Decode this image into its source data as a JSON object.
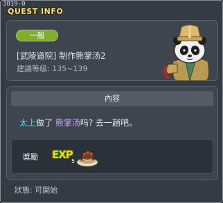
{
  "window": {
    "id_label": "3819-0",
    "title": "QUEST INFO"
  },
  "quest": {
    "category_badge": "一般",
    "name": "[武陵道院] 制作熊掌汤2",
    "level_range": "建議等级: 135~139",
    "npc_icon": "panda-chef-npc-icon"
  },
  "content": {
    "header": "內容",
    "desc_npc": "太上",
    "desc_part1": "做了",
    "desc_item": "熊掌汤",
    "desc_part2": "吗? 去一趟吧。"
  },
  "reward": {
    "label": "獎勵",
    "exp_label": "EXP",
    "exp_sub": "5",
    "item_icon": "bear-paw-soup-icon"
  },
  "status": {
    "text": "狀態: 可開始"
  },
  "colors": {
    "title": "#ffe066",
    "badge": "#7eae2e",
    "npc_highlight": "#4fd8ff",
    "item_highlight": "#c9a7ff"
  }
}
